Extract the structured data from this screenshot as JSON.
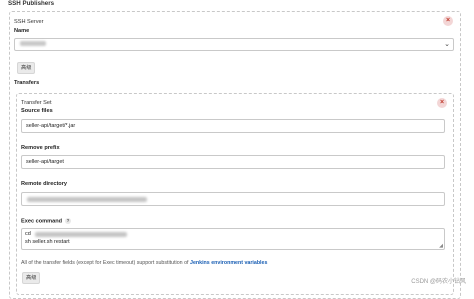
{
  "section_title": "SSH Publishers",
  "server": {
    "heading": "SSH Server",
    "name_label": "Name",
    "name_value_redacted": true,
    "advanced_label": "高级",
    "transfers_label": "Transfers"
  },
  "transfer_set": {
    "heading": "Transfer Set",
    "source_files_label": "Source files",
    "source_files_value": "seller-api/target/*.jar",
    "remove_prefix_label": "Remove prefix",
    "remove_prefix_value": "seller-api/target",
    "remote_directory_label": "Remote directory",
    "exec_command_label": "Exec command",
    "exec_line1_prefix": "cd",
    "exec_line2": "sh seller.sh restart",
    "note_text": "All of the transfer fields (except for Exec timeout) support substitution of ",
    "note_link": "Jenkins environment variables",
    "advanced_label": "高级"
  },
  "help_glyph": "?",
  "close_glyph": "×",
  "chevron_glyph": "⌄",
  "watermark": "CSDN @码农小钻风"
}
